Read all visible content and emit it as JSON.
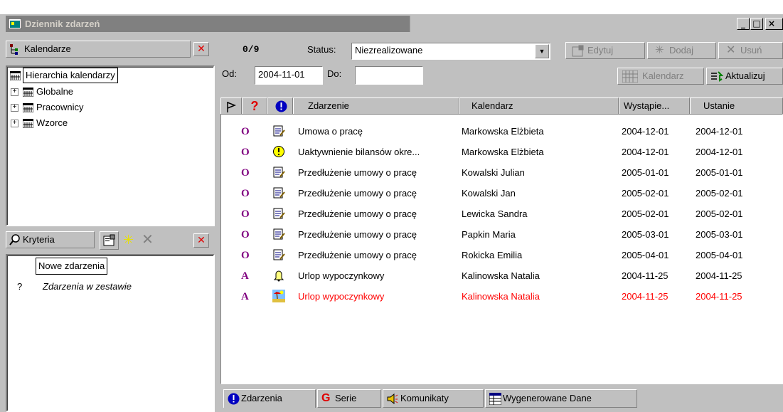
{
  "window": {
    "title": "Dziennik zdarzeń",
    "min": "_",
    "max": "□",
    "close": "×"
  },
  "left": {
    "calendars_label": "Kalendarze",
    "tree_root": "Hierarchia kalendarzy",
    "tree_items": [
      "Globalne",
      "Pracownicy",
      "Wzorce"
    ],
    "criteria_label": "Kryteria",
    "criteria_items": [
      "Nowe zdarzenia",
      "Zdarzenia w zestawie"
    ],
    "criteria_marker": "?"
  },
  "toolbar": {
    "count": "0/9",
    "status_label": "Status:",
    "status_value": "Niezrealizowane",
    "edit_label": "Edytuj",
    "add_label": "Dodaj",
    "delete_label": "Usuń",
    "from_label": "Od:",
    "from_value": "2004-11-01",
    "to_label": "Do:",
    "to_value": "",
    "calendar_button": "Kalendarz",
    "refresh_button": "Aktualizuj"
  },
  "grid": {
    "headers": {
      "event": "Zdarzenie",
      "calendar": "Kalendarz",
      "occurred": "Wystąpie...",
      "set": "Ustanie"
    },
    "rows": [
      {
        "flag": "O",
        "icon": "document-pen-icon",
        "event": "Umowa o pracę",
        "calendar": "Markowska Elżbieta",
        "occurred": "2004-12-01",
        "set": "2004-12-01",
        "highlight": false
      },
      {
        "flag": "O",
        "icon": "warning-circle-icon",
        "event": "Uaktywnienie bilansów okre...",
        "calendar": "Markowska Elżbieta",
        "occurred": "2004-12-01",
        "set": "2004-12-01",
        "highlight": false
      },
      {
        "flag": "O",
        "icon": "document-pen-icon",
        "event": "Przedłużenie umowy o pracę",
        "calendar": "Kowalski Julian",
        "occurred": "2005-01-01",
        "set": "2005-01-01",
        "highlight": false
      },
      {
        "flag": "O",
        "icon": "document-pen-icon",
        "event": "Przedłużenie umowy o pracę",
        "calendar": "Kowalski Jan",
        "occurred": "2005-02-01",
        "set": "2005-02-01",
        "highlight": false
      },
      {
        "flag": "O",
        "icon": "document-pen-icon",
        "event": "Przedłużenie umowy o pracę",
        "calendar": "Lewicka Sandra",
        "occurred": "2005-02-01",
        "set": "2005-02-01",
        "highlight": false
      },
      {
        "flag": "O",
        "icon": "document-pen-icon",
        "event": "Przedłużenie umowy o pracę",
        "calendar": "Papkin Maria",
        "occurred": "2005-03-01",
        "set": "2005-03-01",
        "highlight": false
      },
      {
        "flag": "O",
        "icon": "document-pen-icon",
        "event": "Przedłużenie umowy o pracę",
        "calendar": "Rokicka Emilia",
        "occurred": "2005-04-01",
        "set": "2005-04-01",
        "highlight": false
      },
      {
        "flag": "A",
        "icon": "bell-icon",
        "event": "Urlop wypoczynkowy",
        "calendar": "Kalinowska Natalia",
        "occurred": "2004-11-25",
        "set": "2004-11-25",
        "highlight": false
      },
      {
        "flag": "A",
        "icon": "beach-icon",
        "event": "Urlop wypoczynkowy",
        "calendar": "Kalinowska Natalia",
        "occurred": "2004-11-25",
        "set": "2004-11-25",
        "highlight": true
      }
    ]
  },
  "tabs": [
    "Zdarzenia",
    "Serie",
    "Komunikaty",
    "Wygenerowane Dane"
  ],
  "colors": {
    "highlight": "#ff0000",
    "flag": "#800080",
    "info": "#0000c0"
  }
}
